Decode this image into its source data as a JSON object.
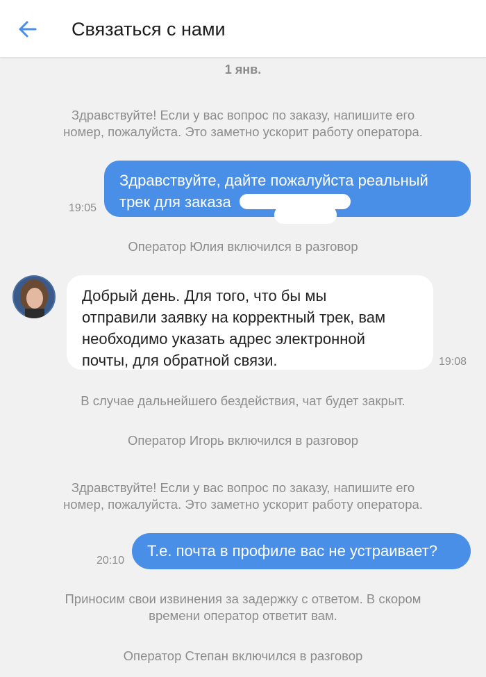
{
  "header": {
    "title": "Связаться с нами"
  },
  "chat": {
    "date": "1 янв.",
    "sys1_line1": "Здравствуйте! Если у вас вопрос по заказу, напишите его",
    "sys1_line2": "номер, пожалуйста. Это заметно ускорит работу оператора.",
    "msg1_line1": "Здравствуйте, дайте пожалуйста реальный",
    "msg1_line2": "трек для заказа",
    "msg1_time": "19:05",
    "sys2": "Оператор Юлия включился в разговор",
    "msg2_line1": "Добрый день. Для того, что бы мы",
    "msg2_line2": "отправили заявку на корректный трек, вам",
    "msg2_line3": "необходимо указать адрес электронной",
    "msg2_line4": "почты, для обратной связи.",
    "msg2_time": "19:08",
    "sys3": "В случае дальнейшего бездействия, чат будет закрыт.",
    "sys4": "Оператор Игорь включился в разговор",
    "sys5_line1": "Здравствуйте! Если у вас вопрос по заказу, напишите его",
    "sys5_line2": "номер, пожалуйста. Это заметно ускорит работу оператора.",
    "msg3": "Т.е. почта в профиле вас не устраивает?",
    "msg3_time": "20:10",
    "sys6_line1": "Приносим свои извинения за задержку с ответом. В скором",
    "sys6_line2": "времени оператор ответит вам.",
    "sys7": "Оператор Степан включился в разговор"
  },
  "colors": {
    "accent": "#4a8fe7",
    "background": "#f1f1f1",
    "system_text": "#8c8c8c"
  },
  "icons": {
    "back": "arrow-left-icon"
  }
}
